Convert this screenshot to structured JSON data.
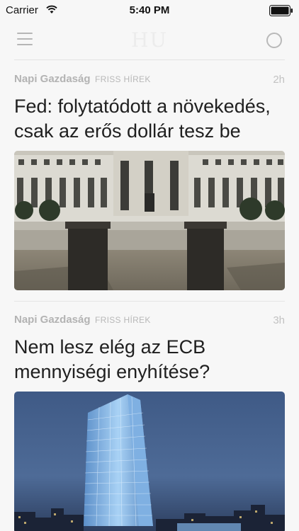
{
  "status_bar": {
    "carrier": "Carrier",
    "time": "5:40 PM"
  },
  "nav": {
    "logo": "HU",
    "menu_icon": "hamburger-menu-icon",
    "search_icon": "search-circle-icon"
  },
  "articles": [
    {
      "source": "Napi Gazdaság",
      "category": "FRISS HÍREK",
      "age": "2h",
      "headline": "Fed: folytatódott a növekedés, csak az erős dollár tesz be",
      "image": "federal-reserve-building-photo"
    },
    {
      "source": "Napi Gazdaság",
      "category": "FRISS HÍREK",
      "age": "3h",
      "headline": "Nem lesz elég az ECB mennyiségi enyhítése?",
      "image": "ecb-tower-night-photo"
    }
  ],
  "colors": {
    "background": "#f7f7f7",
    "meta_gray": "#b3b3b3",
    "headline": "#202020"
  }
}
